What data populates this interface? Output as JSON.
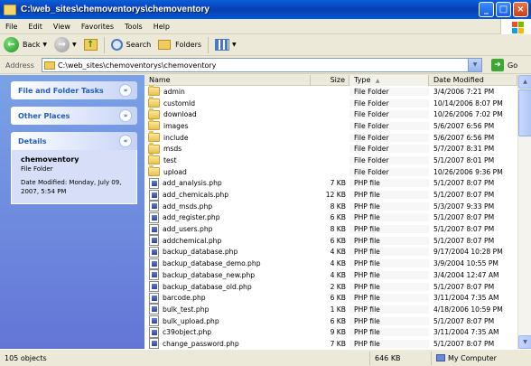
{
  "window": {
    "title": "C:\\web_sites\\chemoventorys\\chemoventory"
  },
  "menu": [
    "File",
    "Edit",
    "View",
    "Favorites",
    "Tools",
    "Help"
  ],
  "toolbar": {
    "back": "Back",
    "search": "Search",
    "folders": "Folders"
  },
  "address": {
    "label": "Address",
    "value": "C:\\web_sites\\chemoventorys\\chemoventory",
    "go": "Go"
  },
  "left": {
    "tasks": "File and Folder Tasks",
    "places": "Other Places",
    "details": {
      "title": "Details",
      "name": "chemoventory",
      "kind": "File Folder",
      "modified": "Date Modified: Monday, July 09, 2007, 5:54 PM"
    }
  },
  "columns": {
    "name": "Name",
    "size": "Size",
    "type": "Type",
    "date": "Date Modified"
  },
  "files": [
    {
      "name": "admin",
      "size": "",
      "type": "File Folder",
      "date": "3/4/2006 7:21 PM",
      "icon": "folder"
    },
    {
      "name": "customId",
      "size": "",
      "type": "File Folder",
      "date": "10/14/2006 8:07 PM",
      "icon": "folder"
    },
    {
      "name": "download",
      "size": "",
      "type": "File Folder",
      "date": "10/26/2006 7:02 PM",
      "icon": "folder"
    },
    {
      "name": "images",
      "size": "",
      "type": "File Folder",
      "date": "5/6/2007 6:56 PM",
      "icon": "folder"
    },
    {
      "name": "include",
      "size": "",
      "type": "File Folder",
      "date": "5/6/2007 6:56 PM",
      "icon": "folder"
    },
    {
      "name": "msds",
      "size": "",
      "type": "File Folder",
      "date": "5/7/2007 8:31 PM",
      "icon": "folder"
    },
    {
      "name": "test",
      "size": "",
      "type": "File Folder",
      "date": "5/1/2007 8:01 PM",
      "icon": "folder"
    },
    {
      "name": "upload",
      "size": "",
      "type": "File Folder",
      "date": "10/26/2006 9:36 PM",
      "icon": "folder"
    },
    {
      "name": "add_analysis.php",
      "size": "7 KB",
      "type": "PHP file",
      "date": "5/1/2007 8:07 PM",
      "icon": "php"
    },
    {
      "name": "add_chemicals.php",
      "size": "12 KB",
      "type": "PHP file",
      "date": "5/1/2007 8:07 PM",
      "icon": "php"
    },
    {
      "name": "add_msds.php",
      "size": "8 KB",
      "type": "PHP file",
      "date": "5/3/2007 9:33 PM",
      "icon": "php"
    },
    {
      "name": "add_register.php",
      "size": "6 KB",
      "type": "PHP file",
      "date": "5/1/2007 8:07 PM",
      "icon": "php"
    },
    {
      "name": "add_users.php",
      "size": "8 KB",
      "type": "PHP file",
      "date": "5/1/2007 8:07 PM",
      "icon": "php"
    },
    {
      "name": "addchemical.php",
      "size": "6 KB",
      "type": "PHP file",
      "date": "5/1/2007 8:07 PM",
      "icon": "php"
    },
    {
      "name": "backup_database.php",
      "size": "4 KB",
      "type": "PHP file",
      "date": "9/17/2004 10:28 PM",
      "icon": "php"
    },
    {
      "name": "backup_database_demo.php",
      "size": "4 KB",
      "type": "PHP file",
      "date": "3/9/2004 10:55 PM",
      "icon": "php"
    },
    {
      "name": "backup_database_new.php",
      "size": "4 KB",
      "type": "PHP file",
      "date": "3/4/2004 12:47 AM",
      "icon": "php"
    },
    {
      "name": "backup_database_old.php",
      "size": "2 KB",
      "type": "PHP file",
      "date": "5/1/2007 8:07 PM",
      "icon": "php"
    },
    {
      "name": "barcode.php",
      "size": "6 KB",
      "type": "PHP file",
      "date": "3/11/2004 7:35 AM",
      "icon": "php"
    },
    {
      "name": "bulk_test.php",
      "size": "1 KB",
      "type": "PHP file",
      "date": "4/18/2006 10:59 PM",
      "icon": "php"
    },
    {
      "name": "bulk_upload.php",
      "size": "6 KB",
      "type": "PHP file",
      "date": "5/1/2007 8:07 PM",
      "icon": "php"
    },
    {
      "name": "c39object.php",
      "size": "9 KB",
      "type": "PHP file",
      "date": "3/11/2004 7:35 AM",
      "icon": "php"
    },
    {
      "name": "change_password.php",
      "size": "7 KB",
      "type": "PHP file",
      "date": "5/1/2007 8:07 PM",
      "icon": "php"
    }
  ],
  "status": {
    "objects": "105 objects",
    "size": "646 KB",
    "location": "My Computer"
  }
}
